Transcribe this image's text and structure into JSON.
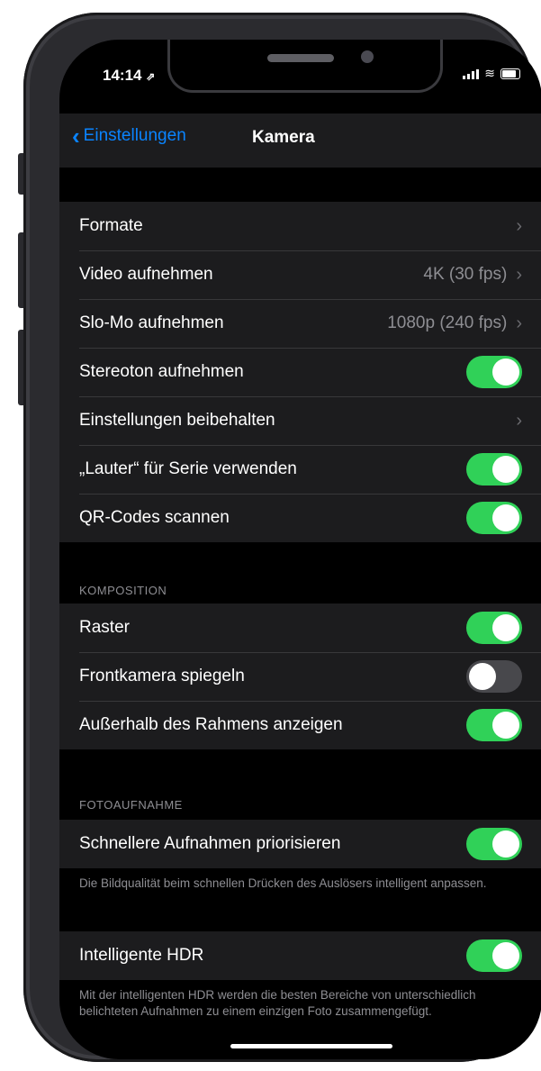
{
  "status_bar": {
    "time": "14:14",
    "location_arrow": "⇗"
  },
  "nav": {
    "back_label": "Einstellungen",
    "title": "Kamera"
  },
  "group1": [
    {
      "label": "Formate",
      "value": "",
      "type": "chevron"
    },
    {
      "label": "Video aufnehmen",
      "value": "4K (30 fps)",
      "type": "chevron"
    },
    {
      "label": "Slo-Mo aufnehmen",
      "value": "1080p (240 fps)",
      "type": "chevron"
    },
    {
      "label": "Stereoton aufnehmen",
      "type": "toggle",
      "on": true
    },
    {
      "label": "Einstellungen beibehalten",
      "value": "",
      "type": "chevron"
    },
    {
      "label": "„Lauter“ für Serie verwenden",
      "type": "toggle",
      "on": true
    },
    {
      "label": "QR-Codes scannen",
      "type": "toggle",
      "on": true
    }
  ],
  "komposition": {
    "header": "KOMPOSITION",
    "rows": [
      {
        "label": "Raster",
        "type": "toggle",
        "on": true
      },
      {
        "label": "Frontkamera spiegeln",
        "type": "toggle",
        "on": false
      },
      {
        "label": "Außerhalb des Rahmens anzeigen",
        "type": "toggle",
        "on": true
      }
    ]
  },
  "fotoaufnahme": {
    "header": "FOTOAUFNAHME",
    "rows": [
      {
        "label": "Schnellere Aufnahmen priorisieren",
        "type": "toggle",
        "on": true
      }
    ],
    "footer": "Die Bildqualität beim schnellen Drücken des Auslösers intelligent anpassen."
  },
  "hdr": {
    "rows": [
      {
        "label": "Intelligente HDR",
        "type": "toggle",
        "on": true
      }
    ],
    "footer": "Mit der intelligenten HDR werden die besten Bereiche von unterschiedlich belichteten Aufnahmen zu einem einzigen Foto zusammengefügt."
  },
  "colors": {
    "accent": "#0a84ff",
    "toggle_on": "#30d158",
    "background": "#000000",
    "cell": "#1c1c1e"
  },
  "icons": {
    "back": "chevron-left-icon",
    "disclosure": "chevron-right-icon",
    "signal": "signal-icon",
    "wifi": "wifi-icon",
    "battery": "battery-icon"
  }
}
